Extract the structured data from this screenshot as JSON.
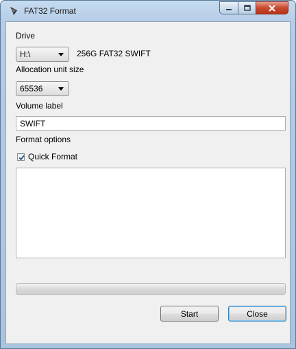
{
  "window": {
    "title": "FAT32 Format"
  },
  "drive": {
    "label": "Drive",
    "selected": "H:\\",
    "description": "256G FAT32 SWIFT"
  },
  "allocation": {
    "label": "Allocation unit size",
    "selected": "65536"
  },
  "volume": {
    "label": "Volume label",
    "value": "SWIFT"
  },
  "format_options": {
    "label": "Format options",
    "quick_format_label": "Quick Format",
    "quick_format_checked": true
  },
  "progress": {
    "fraction": 0
  },
  "buttons": {
    "start": "Start",
    "close": "Close"
  },
  "icons": {
    "app": "app-icon",
    "minimize": "minimize-icon",
    "maximize": "maximize-icon",
    "close": "close-icon"
  },
  "colors": {
    "titlebar": "#b5cde6",
    "close_button": "#c7492e",
    "client_bg": "#f0f0f0"
  }
}
